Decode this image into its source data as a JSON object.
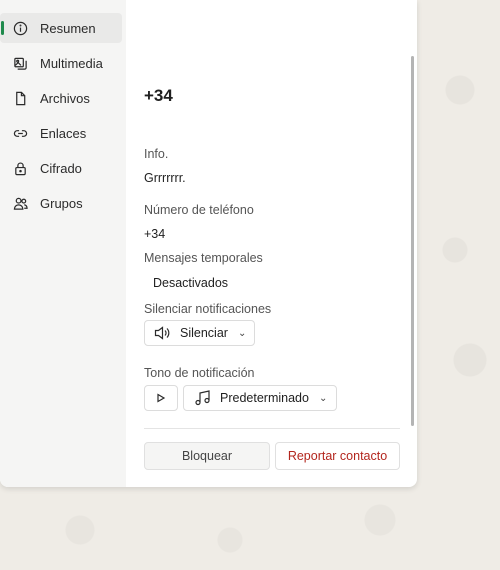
{
  "sidebar": {
    "items": [
      {
        "label": "Resumen",
        "icon": "info-icon",
        "active": true
      },
      {
        "label": "Multimedia",
        "icon": "media-icon"
      },
      {
        "label": "Archivos",
        "icon": "file-icon"
      },
      {
        "label": "Enlaces",
        "icon": "link-icon"
      },
      {
        "label": "Cifrado",
        "icon": "lock-icon"
      },
      {
        "label": "Grupos",
        "icon": "people-icon"
      }
    ]
  },
  "contact": {
    "title": "+34",
    "info_label": "Info.",
    "info_value": "Grrrrrrr.",
    "phone_label": "Número de teléfono",
    "phone_value": "+34",
    "temp_messages_label": "Mensajes temporales",
    "temp_messages_value": "Desactivados",
    "mute_label": "Silenciar notificaciones",
    "mute_button": "Silenciar",
    "tone_label": "Tono de notificación",
    "tone_button": "Predeterminado"
  },
  "actions": {
    "block": "Bloquear",
    "report": "Reportar contacto"
  },
  "colors": {
    "accent": "#1f8a4c",
    "danger": "#b3261e"
  }
}
